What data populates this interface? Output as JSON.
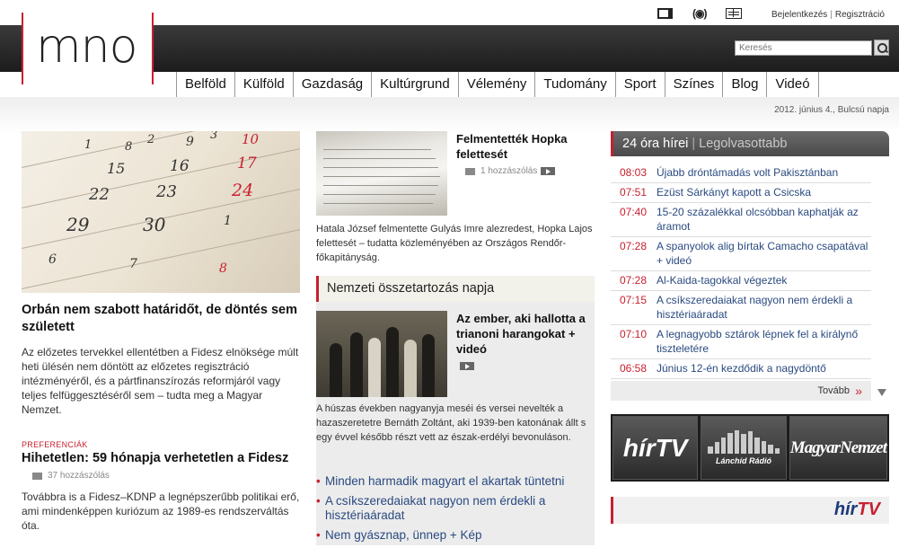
{
  "top": {
    "icons": [
      "screen-icon",
      "radio-icon",
      "newspaper-icon"
    ],
    "radio_glyph": "(◉)",
    "login": "Bejelentkezés",
    "register": "Regisztráció"
  },
  "logo": "mno",
  "search": {
    "placeholder": "Keresés"
  },
  "nav": [
    "Belföld",
    "Külföld",
    "Gazdaság",
    "Kultúrgrund",
    "Vélemény",
    "Tudomány",
    "Sport",
    "Színes",
    "Blog",
    "Videó"
  ],
  "date": "2012. június 4., Bulcsú napja",
  "calendar_numbers": [
    "1",
    "2",
    "3",
    "8",
    "9",
    "10",
    "15",
    "16",
    "17",
    "22",
    "23",
    "24",
    "29",
    "30",
    "1",
    "6",
    "7",
    "8"
  ],
  "col1": {
    "headline": "Orbán nem szabott határidőt, de döntés sem született",
    "lead": "Az előzetes tervekkel ellentétben a Fidesz elnöksége múlt heti ülésén nem döntött az előzetes regisztráció intézményéről, és a pártfinanszírozás reformjáról vagy teljes felfüggesztéséről sem – tudta meg a Magyar Nemzet.",
    "kicker": "Preferenciák",
    "headline2": "Hihetetlen: 59 hónapja verhetetlen a Fidesz",
    "comments2": "37 hozzászólás",
    "lead2": "Továbbra is a Fidesz–KDNP a legnépszerűbb politikai erő, ami mindenképpen kuriózum az 1989-es rendszerváltás óta."
  },
  "col2": {
    "art1_title": "Felmentették Hopka felettesét",
    "art1_comments": "1 hozzászólás",
    "art1_lead": "Hatala József felmentette Gulyás Imre alezredest, Hopka Lajos felettesét – tudatta közleményében az Országos Rendőr-főkapitányság.",
    "panel_title": "Nemzeti összetartozás napja",
    "art2_title": "Az ember, aki hallotta a trianoni harangokat + videó",
    "art2_lead": "A húszas években nagyanyja meséi és versei nevelték a hazaszeretetre Bernáth Zoltánt, aki 1939-ben katonának állt s egy évvel később részt vett az észak-erdélyi bevonuláson.",
    "links": [
      "Minden harmadik magyart el akartak tüntetni",
      "A csíkszeredaiakat nagyon nem érdekli a hisztériaáradat",
      "Nem gyásznap, ünnep + Kép"
    ]
  },
  "col3": {
    "tab_active": "24 óra hírei",
    "tab_inactive": "Legolvasottabb",
    "news": [
      {
        "time": "08:03",
        "title": "Újabb dróntámadás volt Pakisztánban"
      },
      {
        "time": "07:51",
        "title": "Ezüst Sárkányt kapott a Csicska"
      },
      {
        "time": "07:40",
        "title": "15-20 százalékkal olcsóbban kaphatják az áramot"
      },
      {
        "time": "07:28",
        "title": "A spanyolok alig bírtak Camacho csapatával + videó"
      },
      {
        "time": "07:28",
        "title": "Al-Kaida-tagokkal végeztek"
      },
      {
        "time": "07:15",
        "title": "A csíkszeredaiakat nagyon nem érdekli a hisztériaáradat"
      },
      {
        "time": "07:10",
        "title": "A legnagyobb sztárok lépnek fel a királynő tiszteletére"
      },
      {
        "time": "06:58",
        "title": "Június 12-én kezdődik a nagydöntő"
      }
    ],
    "more": "Tovább",
    "banners": [
      "hírTV",
      "Lánchíd Rádió",
      "MagyarNemzet"
    ],
    "hirtv": {
      "a": "hír",
      "b": "TV"
    }
  }
}
